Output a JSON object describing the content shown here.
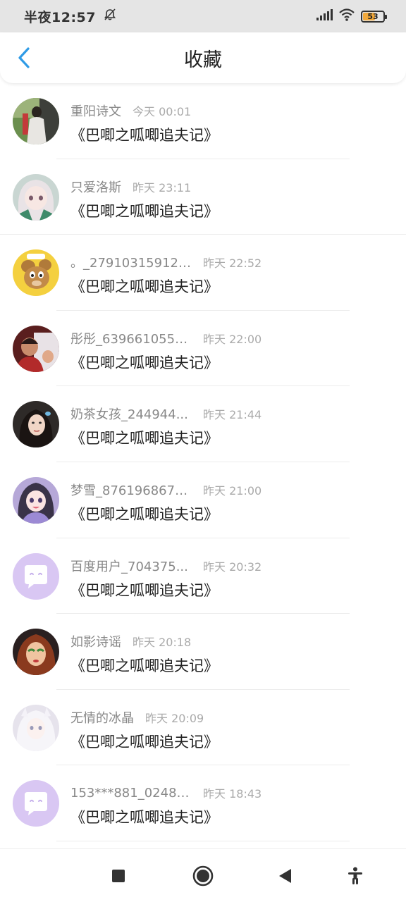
{
  "status_bar": {
    "time": "半夜12:57",
    "battery_level": "53",
    "icons": [
      "bell-off-icon",
      "signal-icon",
      "wifi-icon",
      "battery-icon"
    ]
  },
  "header": {
    "title": "收藏",
    "back_icon": "chevron-left-icon",
    "accent_color": "#2f9be6"
  },
  "items": [
    {
      "user": "重阳诗文",
      "time": "今天 00:01",
      "title": "《巴唧之呱唧追夫记》",
      "avatar": "photo-person"
    },
    {
      "user": "只爱洛斯",
      "time": "昨天 23:11",
      "title": "《巴唧之呱唧追夫记》",
      "avatar": "anime-girl"
    },
    {
      "user": "。_279103159124...",
      "time": "昨天 22:52",
      "title": "《巴唧之呱唧追夫记》",
      "avatar": "cartoon-mouse"
    },
    {
      "user": "彤彤_6396610550...",
      "time": "昨天 22:00",
      "title": "《巴唧之呱唧追夫记》",
      "avatar": "photo-person"
    },
    {
      "user": "奶茶女孩_244944...",
      "time": "昨天 21:44",
      "title": "《巴唧之呱唧追夫记》",
      "avatar": "photo-girl"
    },
    {
      "user": "梦雪_8761968673...",
      "time": "昨天 21:00",
      "title": "《巴唧之呱唧追夫记》",
      "avatar": "anime-girl"
    },
    {
      "user": "百度用户_704375...",
      "time": "昨天 20:32",
      "title": "《巴唧之呱唧追夫记》",
      "avatar": "default-chat"
    },
    {
      "user": "如影诗谣",
      "time": "昨天 20:18",
      "title": "《巴唧之呱唧追夫记》",
      "avatar": "cartoon-face"
    },
    {
      "user": "无情的冰晶",
      "time": "昨天 20:09",
      "title": "《巴唧之呱唧追夫记》",
      "avatar": "anime-white"
    },
    {
      "user": "153***881_02481...",
      "time": "昨天 18:43",
      "title": "《巴唧之呱唧追夫记》",
      "avatar": "default-chat"
    }
  ],
  "nav_bar": {
    "icons": [
      "recent-apps-icon",
      "home-icon",
      "back-icon",
      "accessibility-icon"
    ]
  }
}
